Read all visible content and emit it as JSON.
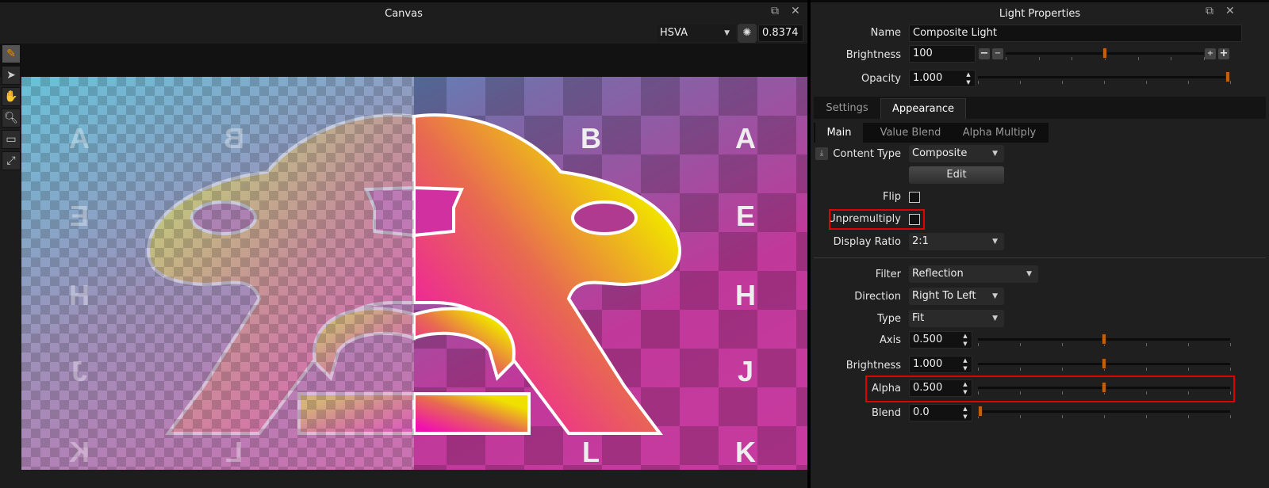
{
  "canvas_panel": {
    "title": "Canvas",
    "color_mode": "HSVA",
    "color_value": "0.8374",
    "tools": [
      "brush-icon",
      "pointer-icon",
      "hand-icon",
      "zoom-icon",
      "zoom-region-icon",
      "zoom-fit-icon"
    ],
    "image_letters_right": [
      "B",
      "A",
      "E",
      "H",
      "J",
      "L",
      "K"
    ],
    "image_letters_left": [
      "A",
      "B",
      "E",
      "H",
      "J",
      "K",
      "L"
    ]
  },
  "light_panel": {
    "title": "Light Properties",
    "name_label": "Name",
    "name_value": "Composite Light",
    "brightness_label": "Brightness",
    "brightness_value": "100",
    "brightness_level": 0.5,
    "opacity_label": "Opacity",
    "opacity_value": "1.000",
    "opacity_level": 1.0,
    "tabs": [
      "Settings",
      "Appearance"
    ],
    "active_tab": "Appearance",
    "subtabs": [
      "Main",
      "Value Blend",
      "Alpha Multiply"
    ],
    "active_subtab": "Main",
    "content_type_label": "Content Type",
    "content_type_value": "Composite",
    "edit_label": "Edit",
    "flip_label": "Flip",
    "flip_checked": false,
    "unpremultiply_label": "Unpremultiply",
    "unpremultiply_checked": false,
    "display_ratio_label": "Display Ratio",
    "display_ratio_value": "2:1",
    "filter_label": "Filter",
    "filter_value": "Reflection",
    "direction_label": "Direction",
    "direction_value": "Right To Left",
    "type_label": "Type",
    "type_value": "Fit",
    "axis_label": "Axis",
    "axis_value": "0.500",
    "axis_level": 0.5,
    "fbrightness_label": "Brightness",
    "fbrightness_value": "1.000",
    "fbrightness_level": 0.5,
    "alpha_label": "Alpha",
    "alpha_value": "0.500",
    "alpha_level": 0.5,
    "blend_label": "Blend",
    "blend_value": "0.0",
    "blend_level": 0.0,
    "accent_color": "#c45f08",
    "highlight_color": "#e00000"
  }
}
